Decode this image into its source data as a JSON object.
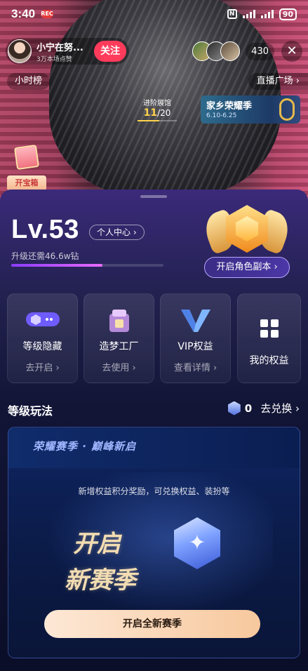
{
  "status_bar": {
    "time": "3:40",
    "record_badge": "REC",
    "nfc": "N",
    "battery": "90"
  },
  "streamer": {
    "name": "小宁在努...",
    "fans": "3万本场点赞",
    "follow_label": "关注"
  },
  "viewers": {
    "count": "430",
    "close_label": "✕"
  },
  "nav": {
    "hour_rank": "小时榜",
    "plaza": "直播广场 ›"
  },
  "stream_progress": {
    "label": "进阶展馆",
    "current": "11",
    "total": "/20",
    "fraction": 0.55
  },
  "season_banner": {
    "title": "家乡荣耀季",
    "dates": "6.10-6.25"
  },
  "treasure": {
    "label": "开宝箱"
  },
  "level_panel": {
    "level": "Lv.53",
    "personal_center": "个人中心 ›",
    "upgrade_need": "升级还需46.6w钻",
    "progress_fraction": 0.6,
    "role_button": "开启角色副本 ›"
  },
  "cards": [
    {
      "title": "等级隐藏",
      "sub": "去开启 ›",
      "icon": "toggle-icon"
    },
    {
      "title": "造梦工厂",
      "sub": "去使用 ›",
      "icon": "factory-icon"
    },
    {
      "title": "VIP权益",
      "sub": "查看详情 ›",
      "icon": "vip-icon"
    },
    {
      "title": "我的权益",
      "sub": "",
      "icon": "grid-icon"
    }
  ],
  "section": {
    "title": "等级玩法",
    "points": "0",
    "exchange": "去兑换 ›"
  },
  "season_card": {
    "header": "荣耀赛季 · 巅峰新启",
    "desc": "新增权益积分奖励，可兑换权益、装扮等",
    "big_line1": "开启",
    "big_line2": "新赛季",
    "button": "开启全新赛季"
  },
  "colors": {
    "follow": "#ff3b5c",
    "accent_purple": "#8a3cff",
    "gold": "#ffd24a"
  }
}
